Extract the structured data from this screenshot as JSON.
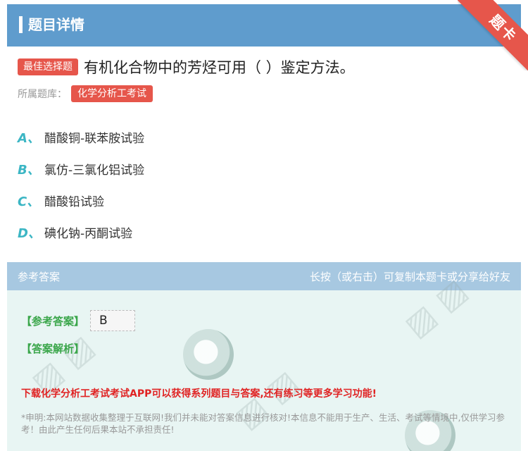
{
  "header": {
    "title": "题目详情",
    "ribbon": "题卡"
  },
  "question": {
    "badge": "最佳选择题",
    "text": "有机化合物中的芳烃可用（ ）鉴定方法。",
    "bank_label": "所属题库：",
    "bank_tag": "化学分析工考试"
  },
  "options": [
    {
      "letter": "A、",
      "text": "醋酸铜-联苯胺试验"
    },
    {
      "letter": "B、",
      "text": "氯仿-三氯化铝试验"
    },
    {
      "letter": "C、",
      "text": "醋酸铅试验"
    },
    {
      "letter": "D、",
      "text": "碘化钠-丙酮试验"
    }
  ],
  "answer": {
    "head_left": "参考答案",
    "head_right": "长按（或右击）可复制本题卡或分享给好友",
    "answer_label": "【参考答案】",
    "answer_value": "B",
    "analysis_label": "【答案解析】",
    "download_text": "下载化学分析工考试考试APP可以获得系列题目与答案,还有练习等更多学习功能!",
    "disclaimer": "*申明:本网站数据收集整理于互联网!我们并未能对答案信息进行核对!本信息不能用于生产、生活、考试等情境中,仅供学习参考！由此产生任何后果本站不承担责任!"
  },
  "colors": {
    "header": "#5f9ccd",
    "accent_red": "#e6564b",
    "option_letter": "#3cb6c4",
    "answer_green": "#3aa64a"
  }
}
